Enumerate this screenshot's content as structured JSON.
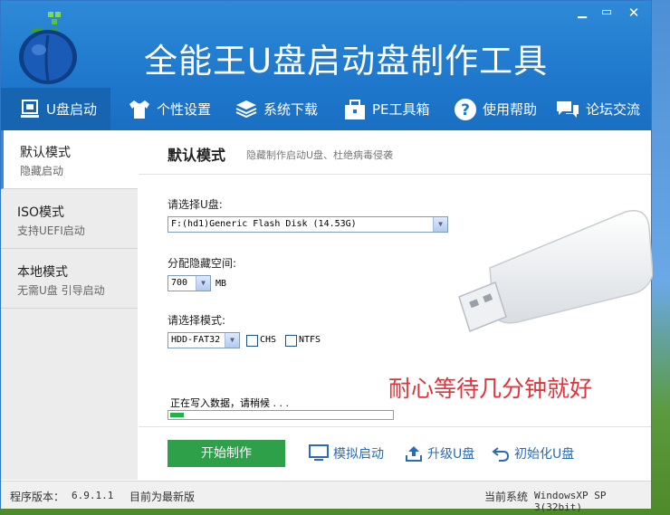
{
  "window": {
    "title": "全能王U盘启动盘制作工具",
    "min_glyph": "▁",
    "restore_glyph": "▭",
    "close_glyph": "✕"
  },
  "nav": {
    "items": [
      {
        "label": "U盘启动",
        "icon": "usb-icon"
      },
      {
        "label": "个性设置",
        "icon": "shirt-icon"
      },
      {
        "label": "系统下载",
        "icon": "layers-icon"
      },
      {
        "label": "PE工具箱",
        "icon": "toolbox-icon"
      },
      {
        "label": "使用帮助",
        "icon": "help-icon"
      },
      {
        "label": "论坛交流",
        "icon": "chat-icon"
      }
    ]
  },
  "sidebar": {
    "items": [
      {
        "title": "默认模式",
        "sub": "隐藏启动"
      },
      {
        "title": "ISO模式",
        "sub": "支持UEFI启动"
      },
      {
        "title": "本地模式",
        "sub": "无需U盘 引导启动"
      }
    ]
  },
  "content": {
    "title": "默认模式",
    "subtitle": "隐藏制作启动U盘、杜绝病毒侵袭",
    "select_usb_label": "请选择U盘:",
    "usb_value": "F:(hd1)Generic Flash Disk (14.53G)",
    "hidden_space_label": "分配隐藏空间:",
    "hidden_space_value": "700",
    "hidden_space_unit": "MB",
    "mode_label": "请选择模式:",
    "mode_value": "HDD-FAT32",
    "chs_label": "CHS",
    "ntfs_label": "NTFS",
    "wait_message": "耐心等待几分钟就好",
    "progress_text": "正在写入数据，请稍候 . . .",
    "progress_fraction": 0.06
  },
  "actions": {
    "start": "开始制作",
    "simulate": "模拟启动",
    "upgrade": "升级U盘",
    "init": "初始化U盘"
  },
  "status": {
    "version_label": "程序版本：",
    "version": "6.9.1.1",
    "latest": "目前为最新版",
    "os_label": "当前系统",
    "os_value": "WindowsXP SP 3(32bit)"
  },
  "colors": {
    "header_blue": "#1f78cc",
    "nav_active": "#1764b0",
    "start_green": "#2fa04a",
    "wait_red": "#e0343a",
    "progress_green": "#23b14d",
    "link_blue": "#2a6bb8"
  }
}
